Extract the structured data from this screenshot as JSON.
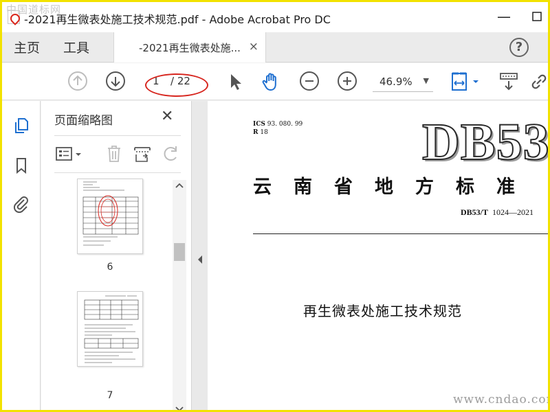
{
  "window": {
    "title": "-2021再生微表处施工技术规范.pdf - Adobe Acrobat Pro DC",
    "minimize_icon": "minimize-icon",
    "maximize_icon": "maximize-icon"
  },
  "watermark": {
    "top": "中国道标网",
    "bottom": "www.cndao.com"
  },
  "tabs": {
    "home": "主页",
    "tools": "工具",
    "document": "-2021再生微表处施...",
    "close_glyph": "×",
    "help_glyph": "?"
  },
  "toolbar": {
    "page_current": "1",
    "page_total": "/ 22",
    "zoom": "46.9%",
    "zoom_caret": "▼"
  },
  "thumbnails_panel": {
    "title": "页面缩略图",
    "close_glyph": "✕",
    "pages": [
      {
        "number": "6"
      },
      {
        "number": "7"
      }
    ]
  },
  "document": {
    "ics_label": "ICS",
    "ics_value": "93. 080. 99",
    "r_label": "R",
    "r_value": "18",
    "code": "DB53",
    "province_line": "云南省地方标准",
    "std_prefix": "DB53/T",
    "std_number": "1024—2021",
    "title": "再生微表处施工技术规范"
  },
  "colors": {
    "accent_blue": "#1e6fd0",
    "highlight_red": "#d7261f",
    "frame_yellow": "#f2e200"
  }
}
